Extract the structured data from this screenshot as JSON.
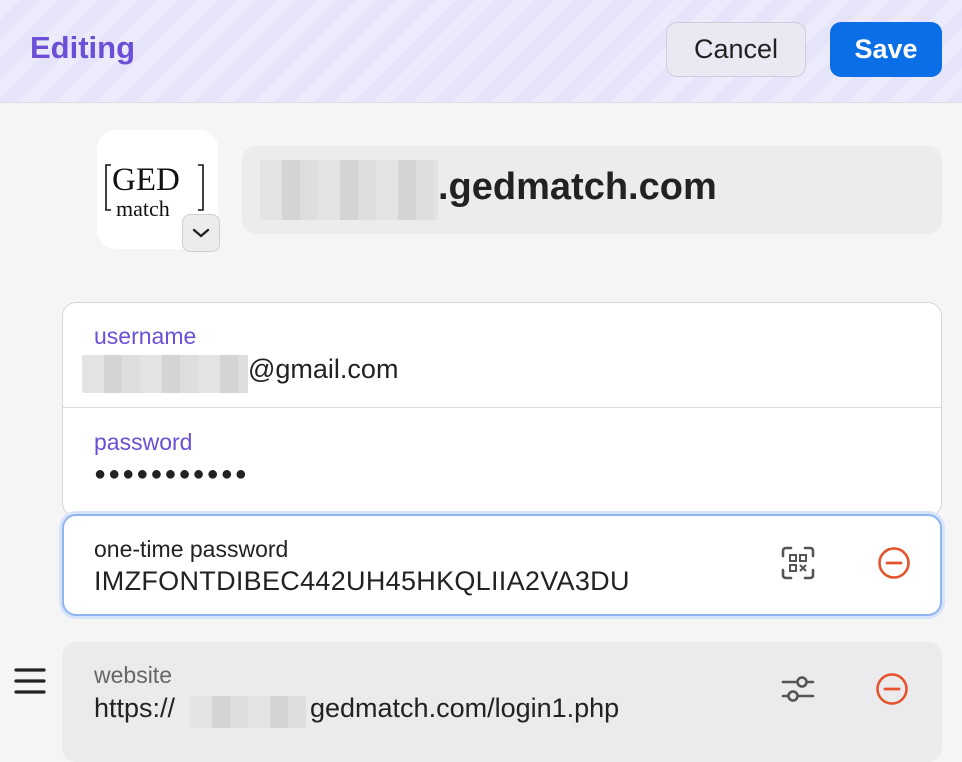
{
  "header": {
    "title": "Editing",
    "cancel_label": "Cancel",
    "save_label": "Save"
  },
  "item": {
    "title_suffix": ".gedmatch.com",
    "logo": {
      "line1": "GED",
      "line2": "match"
    }
  },
  "fields": {
    "username": {
      "label": "username",
      "value_suffix": "@gmail.com"
    },
    "password": {
      "label": "password",
      "value": "●●●●●●●●●●●"
    },
    "otp": {
      "label": "one-time password",
      "value": "IMZFONTDIBEC442UH45HKQLIIA2VA3DU"
    },
    "website": {
      "label": "website",
      "value_prefix": "https://",
      "value_suffix": "gedmatch.com/login1.php"
    }
  },
  "icons": {
    "logo_dropdown": "chevron-down-icon",
    "otp_scan": "qr-scan-icon",
    "remove": "minus-circle-icon",
    "website_settings": "sliders-icon",
    "drag": "hamburger-icon"
  },
  "colors": {
    "accent": "#6b4fd6",
    "primary_button": "#0a6ee6",
    "remove_icon": "#e4532b",
    "focus_ring": "#8fb4ef"
  }
}
